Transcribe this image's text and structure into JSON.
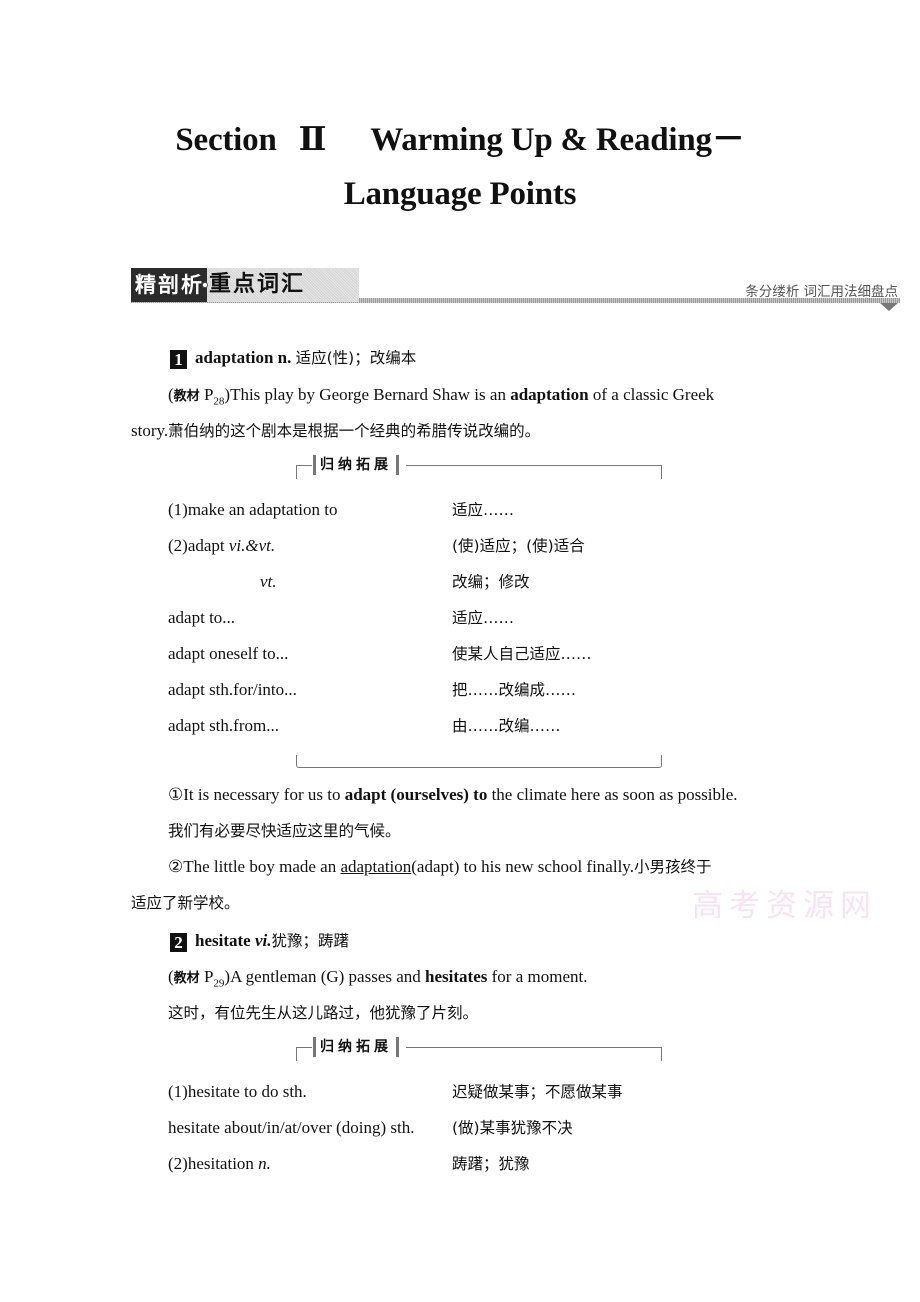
{
  "title": {
    "line1_section": "Section",
    "line1_numeral": "Ⅱ",
    "line1_rest": "Warming Up & Reading－",
    "line2": "Language Points"
  },
  "section_header": {
    "dark_label": "精剖析",
    "light_label": "重点词汇",
    "tagline": "条分缕析  词汇用法细盘点"
  },
  "entries": [
    {
      "number": "1",
      "headword": "adaptation n.",
      "meaning": "适应(性)；改编本",
      "source_label": "教材",
      "source_page": "P",
      "source_page_sub": "28",
      "example_before": ")This play by George Bernard Shaw is an ",
      "example_bold": "adaptation",
      "example_after": " of a classic Greek",
      "example_line2_en": "story.",
      "example_line2_zh": "萧伯纳的这个剧本是根据一个经典的希腊传说改编的。",
      "box_label": "归纳拓展",
      "expansion": [
        {
          "en": "(1)make an adaptation to",
          "zh": "适应……"
        },
        {
          "en_plain": "(2)adapt ",
          "en_italic": "vi.&vt.",
          "zh": "(使)适应；(使)适合"
        },
        {
          "en_italic_only": "vt.",
          "zh": "改编；修改"
        },
        {
          "en": "adapt to...",
          "zh": "适应……"
        },
        {
          "en": "adapt oneself to...",
          "zh": "使某人自己适应……"
        },
        {
          "en": "adapt sth.for/into...",
          "zh": "把……改编成……"
        },
        {
          "en": "adapt sth.from...",
          "zh": "由……改编……"
        }
      ],
      "examples": [
        {
          "marker": "①",
          "before": "It is necessary for us to ",
          "bold": "adapt (ourselves) to",
          "after": " the climate here as soon as possible.",
          "translation": "我们有必要尽快适应这里的气候。"
        },
        {
          "marker": "②",
          "before": "The little boy made an ",
          "underlined": "adaptation",
          "after": "(adapt) to his new school finally.",
          "translation_part1": "小男孩终于",
          "translation_part2": "适应了新学校。"
        }
      ]
    },
    {
      "number": "2",
      "headword": "hesitate ",
      "pos": "vi.",
      "meaning": "犹豫；踌躇",
      "source_label": "教材",
      "source_page": "P",
      "source_page_sub": "29",
      "example_before": ")A gentleman (G) passes and ",
      "example_bold": "hesitates",
      "example_after": " for a moment.",
      "translation": "这时，有位先生从这儿路过，他犹豫了片刻。",
      "box_label": "归纳拓展",
      "expansion": [
        {
          "en": "(1)hesitate to do sth.",
          "zh": "迟疑做某事；不愿做某事"
        },
        {
          "en": "hesitate about/in/at/over (doing) sth.",
          "zh": "(做)某事犹豫不决"
        },
        {
          "en_plain": "(2)hesitation ",
          "en_italic": "n.",
          "zh": "踌躇；犹豫"
        }
      ]
    }
  ],
  "watermark": "高考资源网"
}
